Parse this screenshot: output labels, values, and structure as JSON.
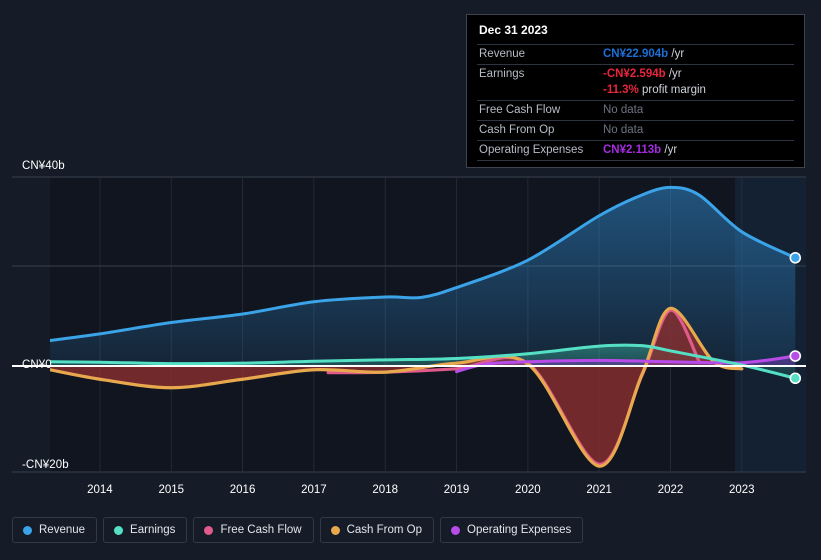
{
  "chart_data": {
    "type": "area",
    "title": "",
    "xlabel": "",
    "ylabel": "",
    "currency": "CN¥",
    "units": "billions",
    "xlim": [
      2013.3,
      2023.9
    ],
    "ylim": [
      -22,
      42
    ],
    "grid": true,
    "legend_position": "bottom",
    "x_ticks": [
      "2014",
      "2015",
      "2016",
      "2017",
      "2018",
      "2019",
      "2020",
      "2021",
      "2022",
      "2023"
    ],
    "y_ticks": [
      "CN¥40b",
      "CN¥0",
      "-CN¥20b"
    ],
    "y_tick_values": [
      40,
      0,
      -20
    ],
    "series": [
      {
        "name": "Revenue",
        "color": "#3ba3e8",
        "x": [
          2013.3,
          2014,
          2015,
          2016,
          2017,
          2018,
          2018.5,
          2019,
          2020,
          2021,
          2021.6,
          2022,
          2022.4,
          2023,
          2023.75
        ],
        "values": [
          5.4,
          6.8,
          9.2,
          11.0,
          13.6,
          14.6,
          14.5,
          16.6,
          22.4,
          31.8,
          36.2,
          37.8,
          36.2,
          28.4,
          22.904
        ]
      },
      {
        "name": "Earnings",
        "color": "#55e0c5",
        "x": [
          2013.3,
          2014,
          2015,
          2016,
          2017,
          2018,
          2019,
          2020,
          2021,
          2021.6,
          2022,
          2023,
          2023.75
        ],
        "values": [
          0.9,
          0.8,
          0.5,
          0.6,
          1.0,
          1.3,
          1.6,
          2.6,
          4.2,
          4.3,
          3.2,
          0.2,
          -2.594
        ]
      },
      {
        "name": "Free Cash Flow",
        "color": "#e05a8a",
        "x": [
          2017.2,
          2018,
          2019,
          2020,
          2021,
          2021.6,
          2022,
          2022.4
        ],
        "values": [
          -1.4,
          -1.3,
          -0.6,
          0.6,
          -20.8,
          -2.0,
          11.8,
          1.0
        ]
      },
      {
        "name": "Cash From Op",
        "color": "#e8a84e",
        "x": [
          2013.3,
          2014,
          2015,
          2016,
          2017,
          2018,
          2019,
          2020,
          2021,
          2021.6,
          2022,
          2022.6,
          2023
        ],
        "values": [
          -0.8,
          -2.8,
          -4.6,
          -2.8,
          -0.8,
          -1.3,
          0.6,
          0.4,
          -21.2,
          -1.8,
          12.2,
          1.0,
          -0.6
        ]
      },
      {
        "name": "Operating Expenses",
        "color": "#b84ce8",
        "x": [
          2019,
          2019.4,
          2020,
          2021,
          2022,
          2023,
          2023.75
        ],
        "values": [
          -1.2,
          0.4,
          0.9,
          1.2,
          0.9,
          0.7,
          2.113
        ]
      }
    ],
    "endpoint_markers": [
      {
        "series": "Revenue",
        "value": 22.904,
        "color": "#3ba3e8"
      },
      {
        "series": "Operating Expenses",
        "value": 2.113,
        "color": "#b84ce8"
      },
      {
        "series": "Earnings",
        "value": -2.594,
        "color": "#55e0c5"
      }
    ]
  },
  "tooltip": {
    "date": "Dec 31 2023",
    "rows": [
      {
        "key": "Revenue",
        "value": "CN¥22.904b",
        "unit": " /yr",
        "style": "rev"
      },
      {
        "key": "Earnings",
        "value": "-CN¥2.594b",
        "unit": " /yr",
        "style": "earn"
      },
      {
        "key": "",
        "value": "-11.3%",
        "unit": " profit margin",
        "style": "earn"
      },
      {
        "key": "Free Cash Flow",
        "value": "No data",
        "unit": "",
        "style": "none"
      },
      {
        "key": "Cash From Op",
        "value": "No data",
        "unit": "",
        "style": "none"
      },
      {
        "key": "Operating Expenses",
        "value": "CN¥2.113b",
        "unit": " /yr",
        "style": "opex"
      }
    ]
  },
  "legend": {
    "items": [
      {
        "label": "Revenue",
        "color": "#3ba3e8"
      },
      {
        "label": "Earnings",
        "color": "#55e0c5"
      },
      {
        "label": "Free Cash Flow",
        "color": "#e05a8a"
      },
      {
        "label": "Cash From Op",
        "color": "#e8a84e"
      },
      {
        "label": "Operating Expenses",
        "color": "#b84ce8"
      }
    ]
  }
}
